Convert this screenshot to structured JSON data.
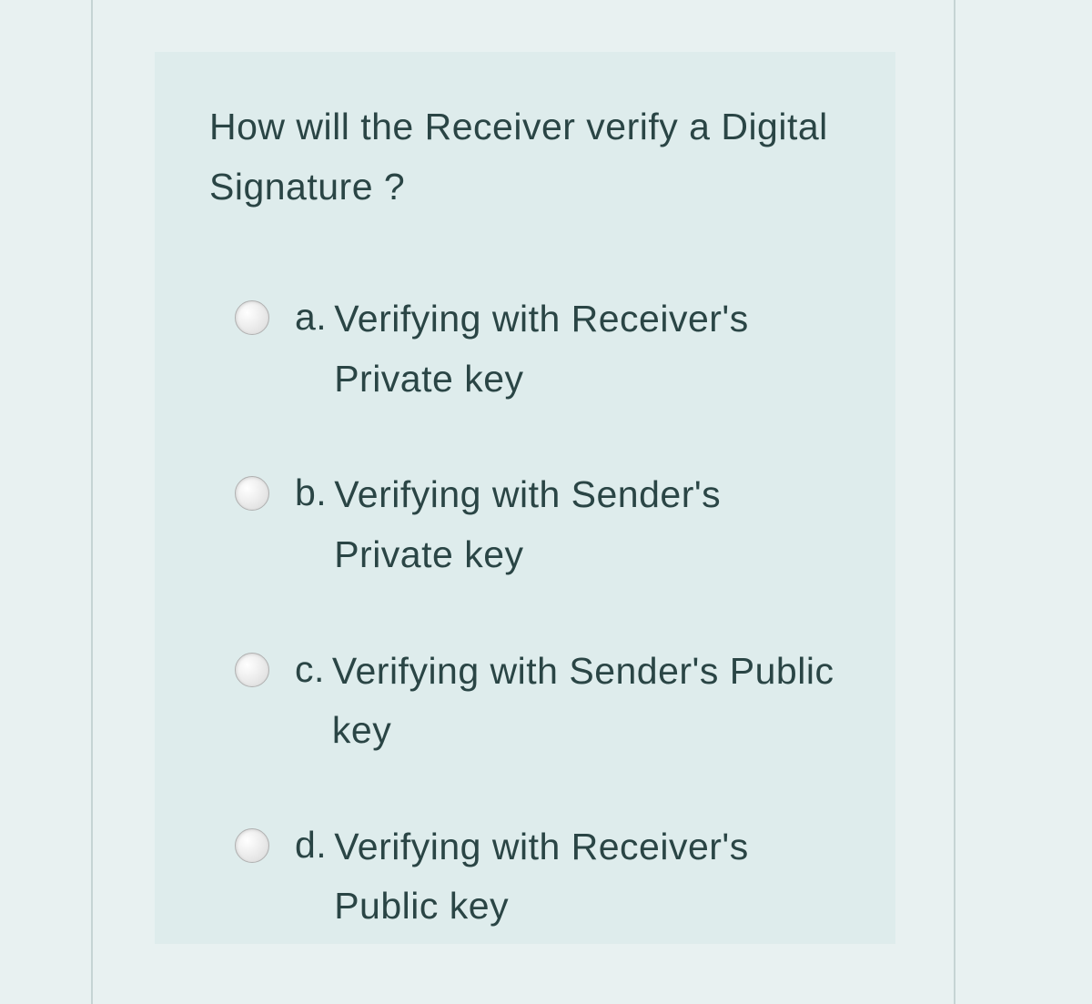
{
  "question": {
    "text": "How will the Receiver verify a Digital Signature ?",
    "options": [
      {
        "letter": "a.",
        "text": "Verifying with Receiver's Private key"
      },
      {
        "letter": "b.",
        "text": "Verifying with Sender's Private key"
      },
      {
        "letter": "c.",
        "text": "Verifying with Sender's Public key"
      },
      {
        "letter": "d.",
        "text": "Verifying with Receiver's Public key"
      }
    ]
  }
}
